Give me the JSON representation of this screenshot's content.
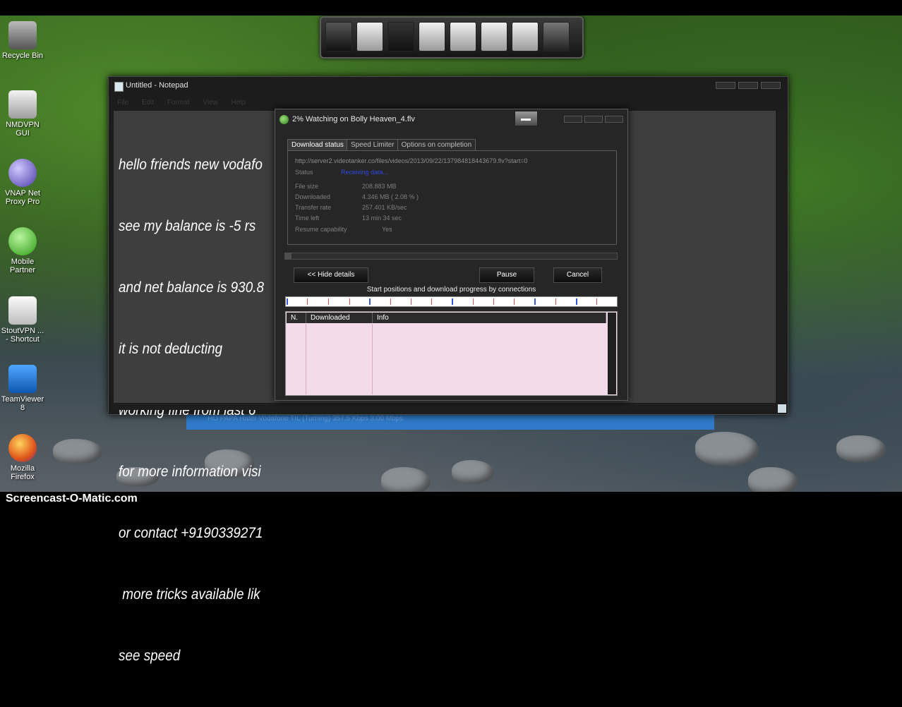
{
  "watermark": "Screencast-O-Matic.com",
  "desktop_icons": [
    {
      "label": "Recycle Bin",
      "color": "#9a9a9a"
    },
    {
      "label": "NMDVPN GUI",
      "color": "#d8d8d8"
    },
    {
      "label": "VNAP Net Proxy Pro",
      "color": "#7b6fd0"
    },
    {
      "label": "Mobile Partner",
      "color": "#48c02c"
    },
    {
      "label": "StoutVPN ... - Shortcut",
      "color": "#ededed"
    },
    {
      "label": "TeamViewer 8",
      "color": "#1f7fd8"
    },
    {
      "label": "Mozilla Firefox",
      "color": "#e8621c"
    }
  ],
  "notepad": {
    "title": "Untitled - Notepad",
    "menu": [
      "File",
      "Edit",
      "Format",
      "View",
      "Help"
    ],
    "lines": [
      "hello friends new vodafo",
      "see my balance is -5 rs",
      "and net balance is 930.8",
      "it is not deducting",
      "working fine from last 6 ",
      "for more information visi",
      "or contact +9190339271",
      " more tricks available lik",
      "see speed"
    ]
  },
  "idm": {
    "title": "2% Watching on Bolly Heaven_4.flv",
    "tabs": [
      "Download status",
      "Speed Limiter",
      "Options on completion"
    ],
    "url": "http://server2.videotanker.co/files/videos/2013/09/22/137984818443679.flv?start=0",
    "status_label": "Status",
    "status_value": "Receiving data...",
    "fields": [
      {
        "label": "File size",
        "value": "208.883  MB"
      },
      {
        "label": "Downloaded",
        "value": "4.346  MB  ( 2.08 % )"
      },
      {
        "label": "Transfer rate",
        "value": "257.401  KB/sec"
      },
      {
        "label": "Time left",
        "value": "13 min 34 sec"
      },
      {
        "label": "Resume capability",
        "value": "Yes"
      }
    ],
    "progress_fraction": 0.02,
    "hide_details_label": "<< Hide details",
    "pause_label": "Pause",
    "cancel_label": "Cancel",
    "connections_caption": "Start positions and download progress by connections",
    "table_headers": [
      "N.",
      "Downloaded",
      "Info"
    ],
    "accent_status_color": "#2f49e0"
  },
  "taskbar_strip": {
    "text": "HO PAPA Hater Vodafone TIL (Turning)     357.5 Kbps     3.00 Mbps"
  }
}
